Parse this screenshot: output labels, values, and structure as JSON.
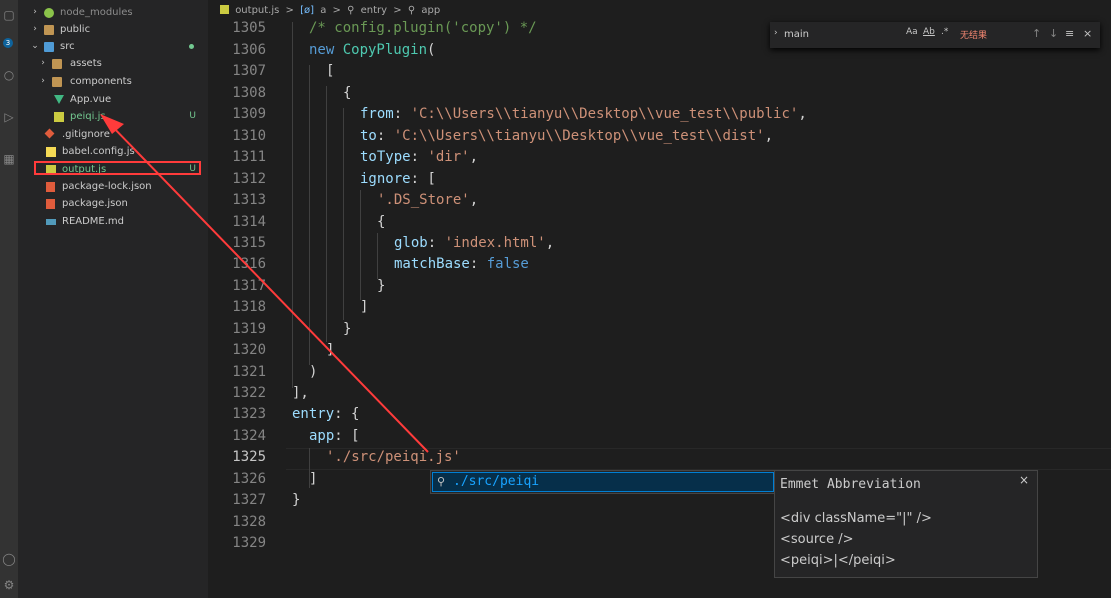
{
  "sidebar": {
    "items": [
      {
        "label": "node_modules",
        "status": ""
      },
      {
        "label": "public",
        "status": ""
      },
      {
        "label": "src",
        "status": ""
      },
      {
        "label": "assets",
        "status": ""
      },
      {
        "label": "components",
        "status": ""
      },
      {
        "label": "App.vue",
        "status": ""
      },
      {
        "label": "peiqi.js",
        "status": "U"
      },
      {
        "label": ".gitignore",
        "status": ""
      },
      {
        "label": "babel.config.js",
        "status": ""
      },
      {
        "label": "output.js",
        "status": "U"
      },
      {
        "label": "package-lock.json",
        "status": ""
      },
      {
        "label": "package.json",
        "status": ""
      },
      {
        "label": "README.md",
        "status": ""
      }
    ],
    "badge": "3"
  },
  "breadcrumb": {
    "file": "output.js",
    "sep": ">",
    "sym1": "a",
    "sym2": "entry",
    "sym3": "app"
  },
  "find": {
    "value": "main",
    "opt_case": "Aa",
    "opt_word": "Ab",
    "opt_regex": ".*",
    "no_results": "无结果"
  },
  "editor": {
    "line_numbers": [
      "1305",
      "1306",
      "1307",
      "1308",
      "1309",
      "1310",
      "1311",
      "1312",
      "1313",
      "1314",
      "1315",
      "1316",
      "1317",
      "1318",
      "1319",
      "1320",
      "1321",
      "1322",
      "1323",
      "1324",
      "1325",
      "1326",
      "1327",
      "1328",
      "1329"
    ],
    "active_line": "1325",
    "code": {
      "l1305": "/* config.plugin('copy') */",
      "l1306a": "new ",
      "l1306b": "CopyPlugin",
      "l1306c": "(",
      "l1307": "[",
      "l1308": "{",
      "l1309a": "from",
      "l1309b": ": ",
      "l1309c": "'C:\\\\Users\\\\tianyu\\\\Desktop\\\\vue_test\\\\public'",
      "l1309d": ",",
      "l1310a": "to",
      "l1310b": ": ",
      "l1310c": "'C:\\\\Users\\\\tianyu\\\\Desktop\\\\vue_test\\\\dist'",
      "l1310d": ",",
      "l1311a": "toType",
      "l1311b": ": ",
      "l1311c": "'dir'",
      "l1311d": ",",
      "l1312a": "ignore",
      "l1312b": ": [",
      "l1313a": "'.DS_Store'",
      "l1313b": ",",
      "l1314": "{",
      "l1315a": "glob",
      "l1315b": ": ",
      "l1315c": "'index.html'",
      "l1315d": ",",
      "l1316a": "matchBase",
      "l1316b": ": ",
      "l1316c": "false",
      "l1317": "}",
      "l1318": "]",
      "l1319": "}",
      "l1320": "]",
      "l1321": ")",
      "l1322": "],",
      "l1323a": "entry",
      "l1323b": ": {",
      "l1324a": "app",
      "l1324b": ": [",
      "l1325": "'./src/peiqi.js'",
      "l1326": "]",
      "l1327": "}"
    }
  },
  "suggest": {
    "item": "./src/peiqi",
    "detail_title": "Emmet Abbreviation",
    "detail_lines": [
      "<div className=\"|\" />",
      "<source />",
      "<peiqi>|</peiqi>"
    ],
    "close": "×"
  }
}
